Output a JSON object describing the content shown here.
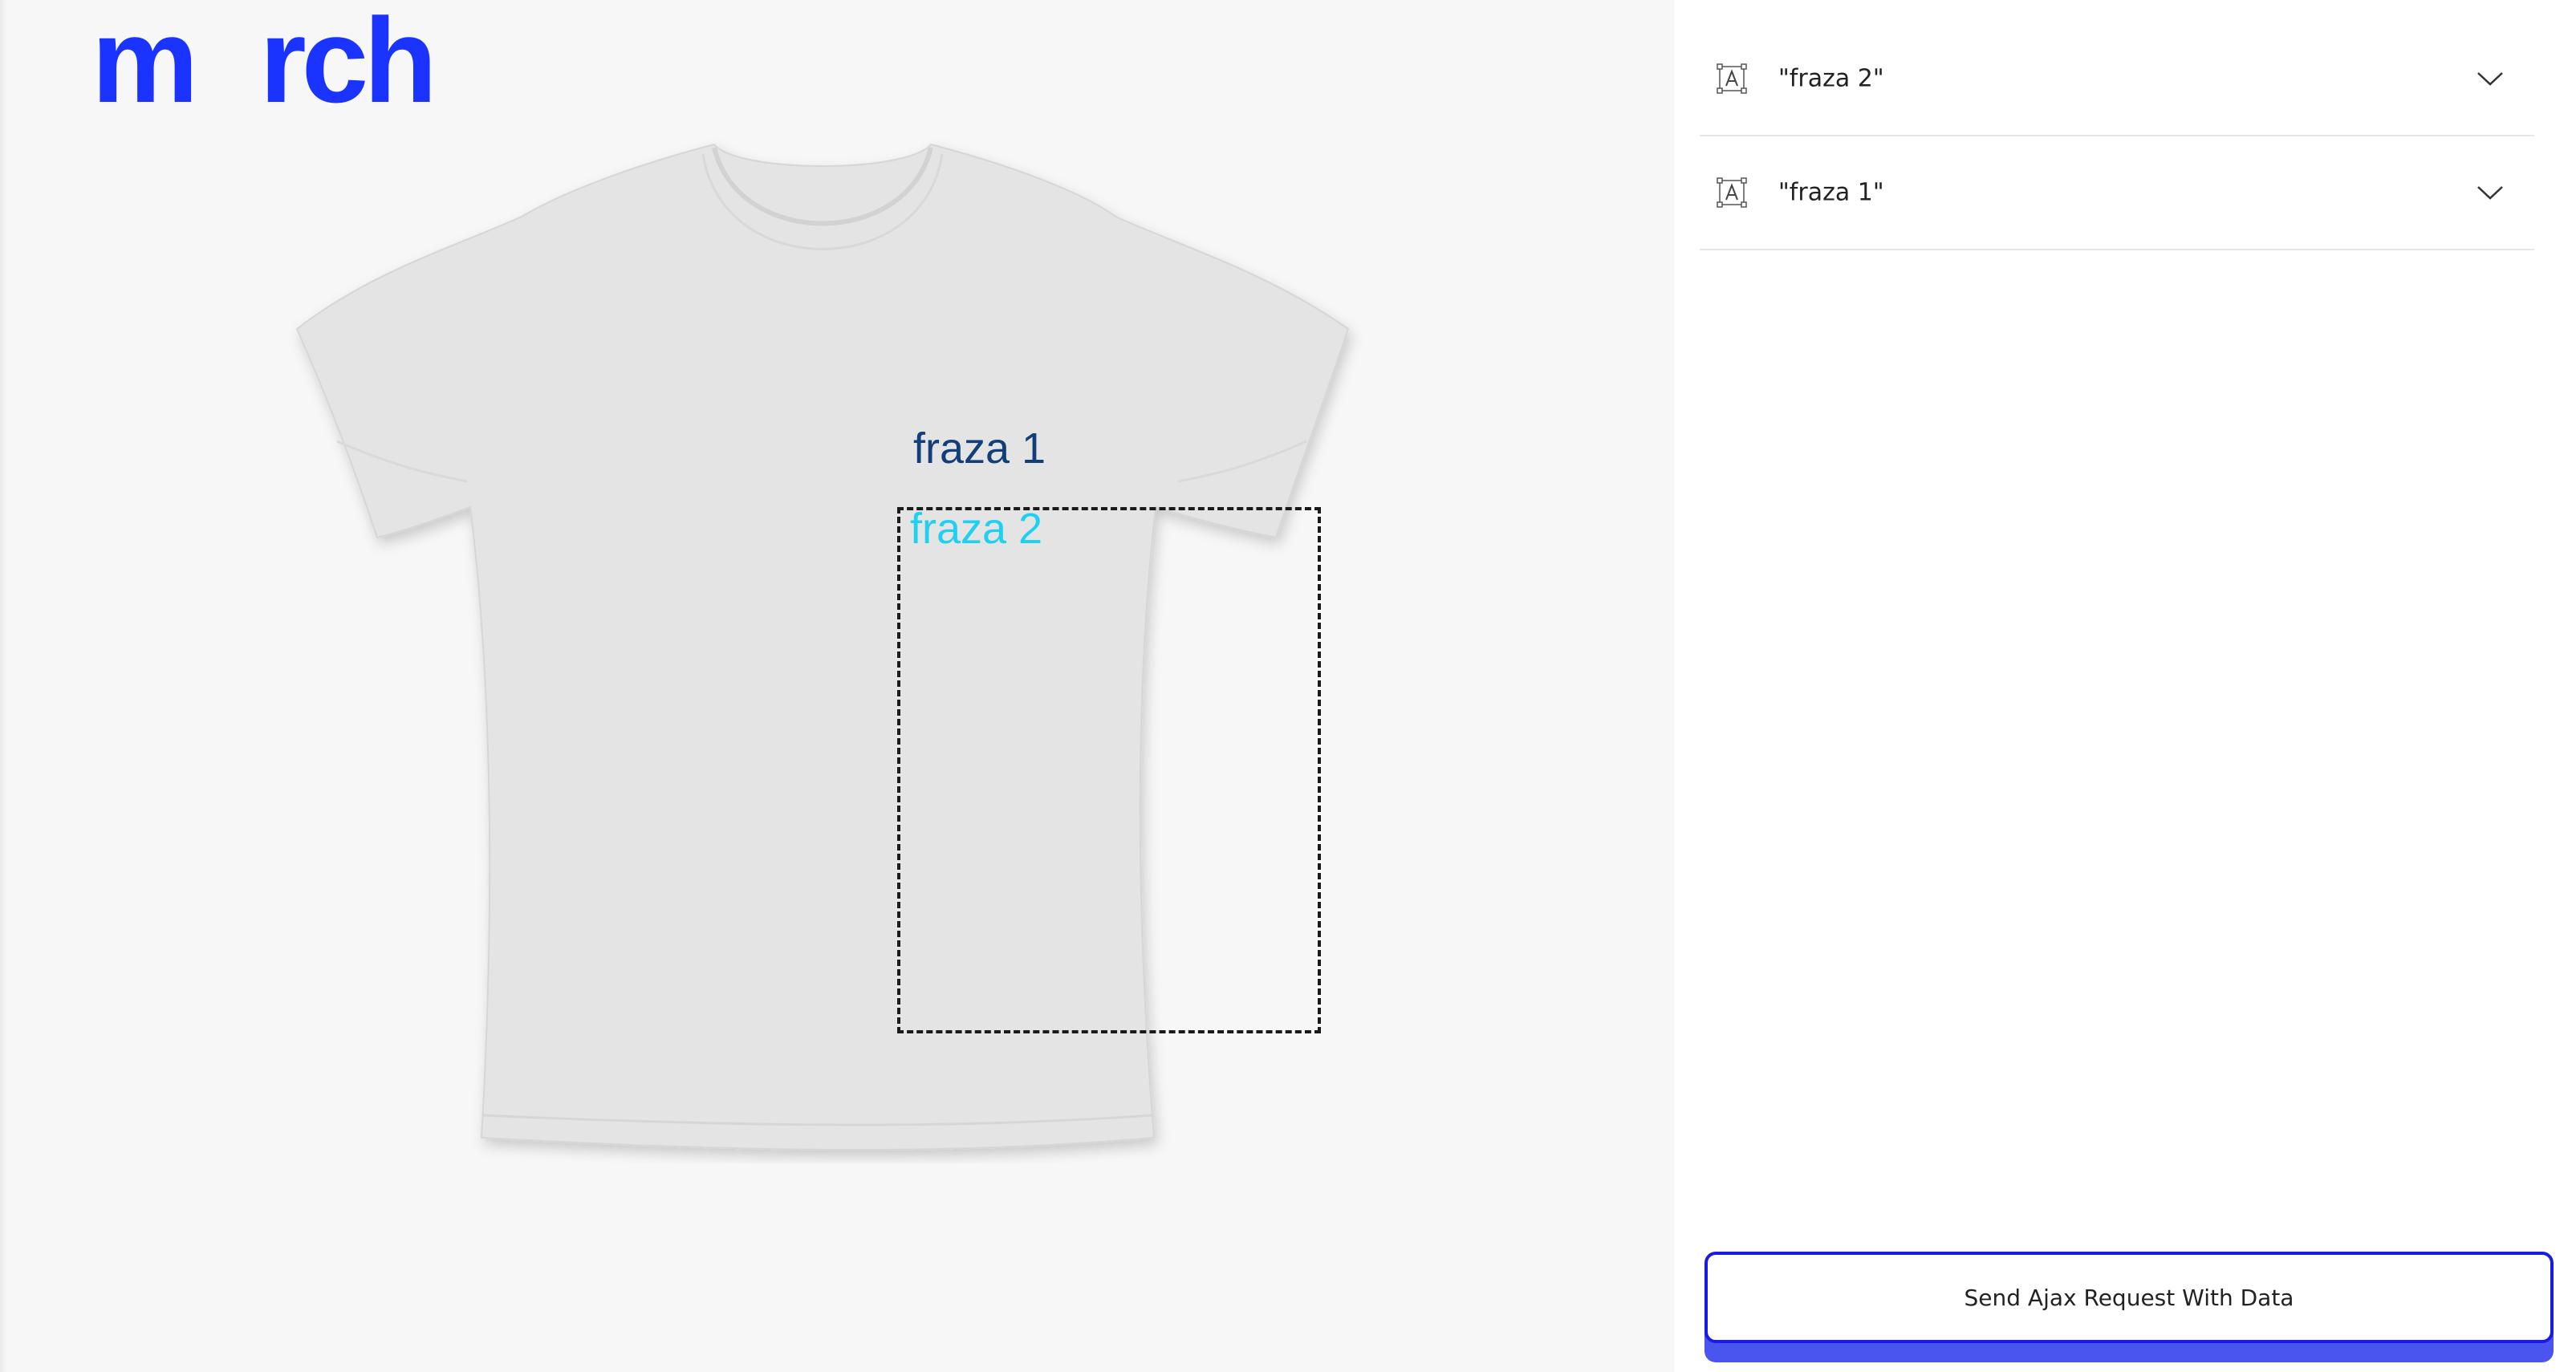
{
  "logo": {
    "part1": "m",
    "part2": "rch",
    "color": "#1a33ff"
  },
  "canvas": {
    "product_color": "#e4e4e4",
    "phrases": [
      {
        "text": "fraza 1",
        "color": "#123f7a"
      },
      {
        "text": "fraza 2",
        "color": "#1fd0f0"
      }
    ]
  },
  "layers": [
    {
      "label": "\"fraza 2\"",
      "icon": "text-layer-icon",
      "toggle_icon": "chevron-down-icon"
    },
    {
      "label": "\"fraza 1\"",
      "icon": "text-layer-icon",
      "toggle_icon": "chevron-down-icon"
    }
  ],
  "actions": {
    "send_label": "Send Ajax Request With Data",
    "accent": "#1a1ae6"
  }
}
